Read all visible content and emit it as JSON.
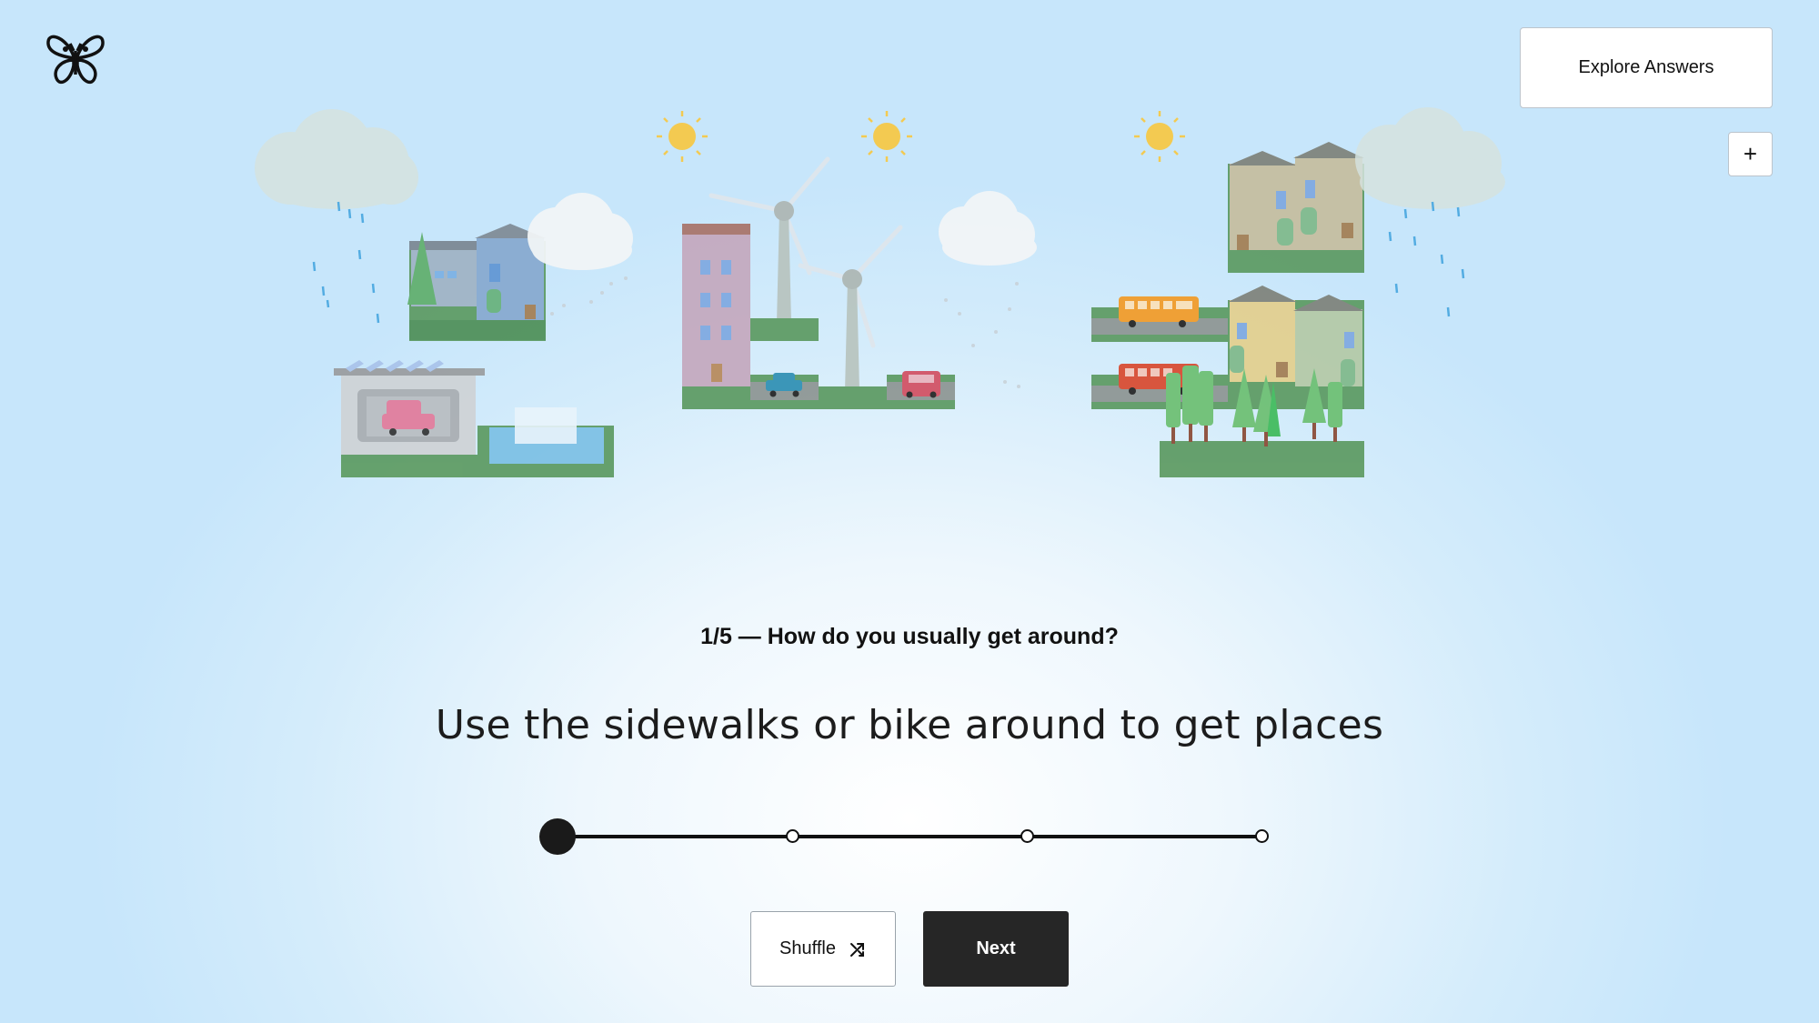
{
  "header": {
    "logo_icon": "butterfly-icon",
    "explore_label": "Explore Answers",
    "add_label": "+"
  },
  "question": {
    "text": "1/5 — How do you usually get around?"
  },
  "answer": {
    "text": "Use the sidewalks or bike around to get places"
  },
  "slider": {
    "steps": 4,
    "selected_index": 0
  },
  "actions": {
    "shuffle_label": "Shuffle",
    "shuffle_icon": "shuffle-icon",
    "next_label": "Next"
  },
  "colors": {
    "next_bg": "#262626",
    "sun": "#f7c843",
    "grass": "#4e9b5a",
    "rain": "#4aa8e0"
  }
}
